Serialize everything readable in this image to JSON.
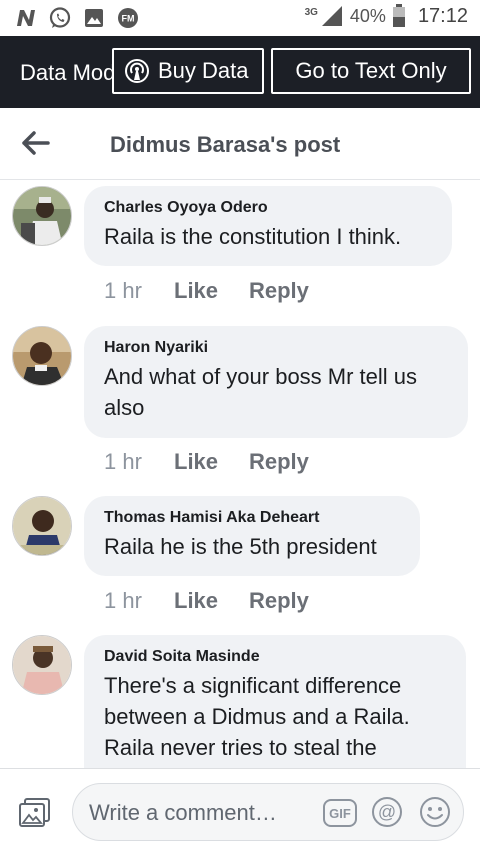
{
  "status_bar": {
    "network": "3G",
    "battery": "40%",
    "time": "17:12",
    "icons": [
      "n-icon",
      "whatsapp-icon",
      "gallery-icon",
      "fm-radio-icon",
      "signal-icon",
      "battery-icon"
    ]
  },
  "data_bar": {
    "mode_text": "Data Mode",
    "buy_label": "Buy Data",
    "text_only_label": "Go to Text Only"
  },
  "header": {
    "title": "Didmus Barasa's post"
  },
  "comments": [
    {
      "author": "Charles Oyoya Odero",
      "text": "Raila is the constitution I think.",
      "time": "1 hr",
      "like": "Like",
      "reply": "Reply"
    },
    {
      "author": "Haron Nyariki",
      "text": "And what of your boss Mr tell us also",
      "time": "1 hr",
      "like": "Like",
      "reply": "Reply"
    },
    {
      "author": "Thomas Hamisi Aka Deheart",
      "text": "Raila he is the 5th president",
      "time": "1 hr",
      "like": "Like",
      "reply": "Reply"
    },
    {
      "author": "David Soita Masinde",
      "text": "There's a significant difference between a Didmus and a Raila. Raila never tries to steal the",
      "time": "",
      "like": "",
      "reply": ""
    }
  ],
  "composer": {
    "placeholder": "Write a comment…",
    "gif_label": "GIF"
  },
  "colors": {
    "data_bar_bg": "#1c1f26",
    "bubble_bg": "#f0f2f5",
    "meta_text": "#8d949e"
  }
}
